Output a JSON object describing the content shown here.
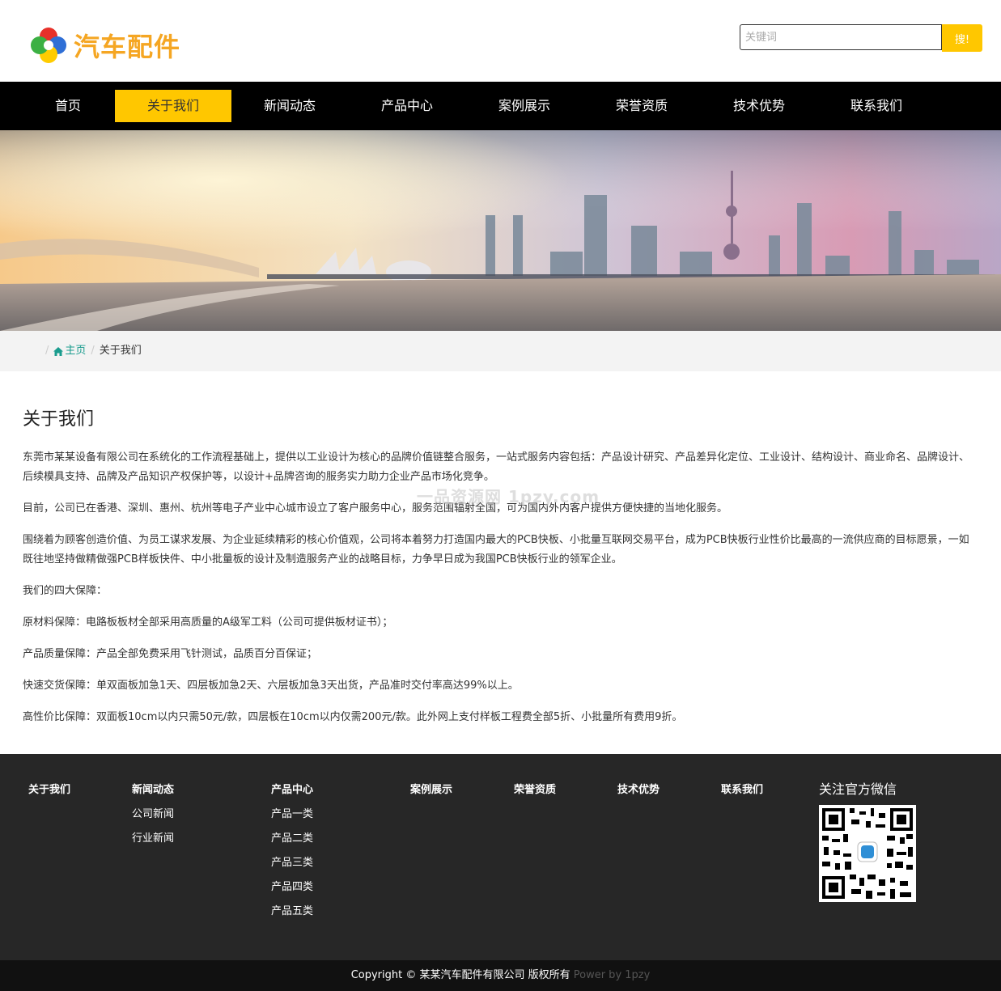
{
  "header": {
    "logo_text": "汽车配件",
    "search": {
      "placeholder": "关键词",
      "button": "搜!"
    }
  },
  "nav": {
    "items": [
      "首页",
      "关于我们",
      "新闻动态",
      "产品中心",
      "案例展示",
      "荣誉资质",
      "技术优势",
      "联系我们"
    ],
    "active_index": 1
  },
  "breadcrumb": {
    "home": "主页",
    "current": "关于我们"
  },
  "main": {
    "title": "关于我们",
    "paragraphs": [
      "东莞市某某设备有限公司在系统化的工作流程基础上，提供以工业设计为核心的品牌价值链整合服务，一站式服务内容包括：产品设计研究、产品差异化定位、工业设计、结构设计、商业命名、品牌设计、后续模具支持、品牌及产品知识产权保护等，以设计+品牌咨询的服务实力助力企业产品市场化竞争。",
      "目前，公司已在香港、深圳、惠州、杭州等电子产业中心城市设立了客户服务中心，服务范围辐射全国，可为国内外内客户提供方便快捷的当地化服务。",
      "围绕着为顾客创造价值、为员工谋求发展、为企业延续精彩的核心价值观，公司将本着努力打造国内最大的PCB快板、小批量互联网交易平台，成为PCB快板行业性价比最高的一流供应商的目标愿景，一如既往地坚持做精做强PCB样板快件、中小批量板的设计及制造服务产业的战略目标，力争早日成为我国PCB快板行业的领军企业。",
      "我们的四大保障：",
      "原材料保障：电路板板材全部采用高质量的A级军工料（公司可提供板材证书）；",
      "产品质量保障：产品全部免费采用飞针测试，品质百分百保证；",
      "快速交货保障：单双面板加急1天、四层板加急2天、六层板加急3天出货，产品准时交付率高达99%以上。",
      "高性价比保障：双面板10cm以内只需50元/款，四层板在10cm以内仅需200元/款。此外网上支付样板工程费全部5折、小批量所有费用9折。"
    ],
    "watermark": "一品资源网 1pzy.com"
  },
  "footer": {
    "columns": [
      {
        "title": "关于我们",
        "links": []
      },
      {
        "title": "新闻动态",
        "links": [
          "公司新闻",
          "行业新闻"
        ]
      },
      {
        "title": "产品中心",
        "links": [
          "产品一类",
          "产品二类",
          "产品三类",
          "产品四类",
          "产品五类"
        ]
      },
      {
        "title": "案例展示",
        "links": []
      },
      {
        "title": "荣誉资质",
        "links": []
      },
      {
        "title": "技术优势",
        "links": []
      },
      {
        "title": "联系我们",
        "links": []
      }
    ],
    "wechat_title": "关注官方微信",
    "copyright": "Copyright © 某某汽车配件有限公司 版权所有",
    "powered": "Power by 1pzy"
  },
  "colors": {
    "accent": "#ffc700",
    "nav_bg": "#000000",
    "footer_bg": "#272727",
    "link": "#1a9c8e"
  }
}
